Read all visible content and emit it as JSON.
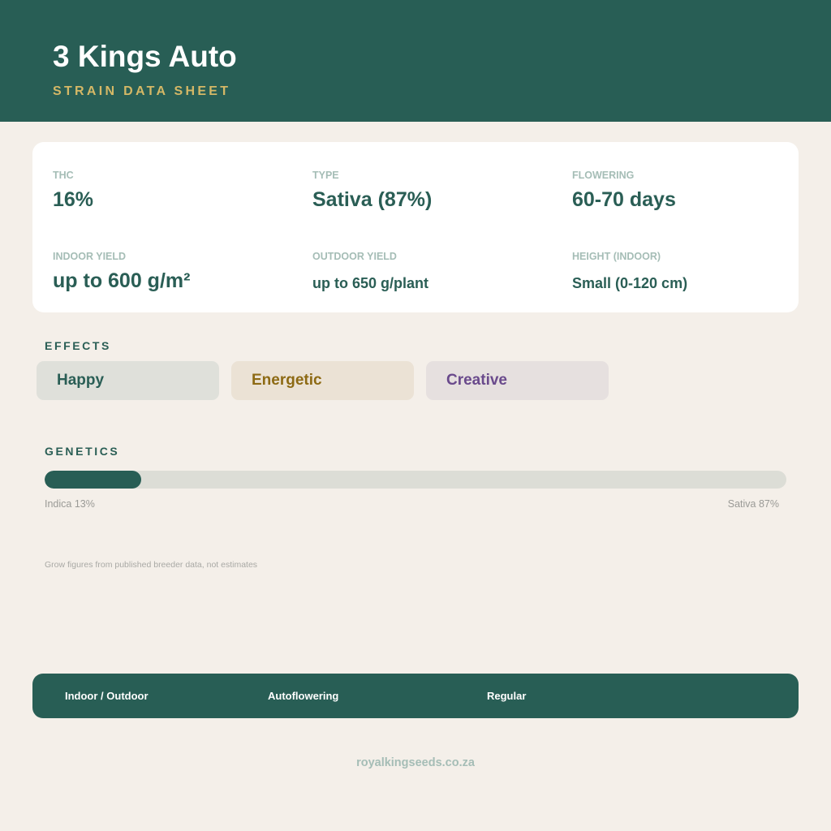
{
  "header": {
    "title": "3 Kings Auto",
    "subtitle": "STRAIN DATA SHEET"
  },
  "stats": [
    {
      "label": "THC",
      "value": "16%"
    },
    {
      "label": "TYPE",
      "value": "Sativa (87%)"
    },
    {
      "label": "FLOWERING",
      "value": "60-70 days"
    },
    {
      "label": "INDOOR YIELD",
      "value": "up to 600 g/m²"
    },
    {
      "label": "OUTDOOR YIELD",
      "value": "up to 650 g/plant"
    },
    {
      "label": "HEIGHT (INDOOR)",
      "value": "Small (0-120 cm)"
    }
  ],
  "effects": {
    "title": "EFFECTS",
    "items": [
      {
        "label": "Happy",
        "color": "#2a5e55",
        "background": "#dfe0da"
      },
      {
        "label": "Energetic",
        "color": "#8d6a14",
        "background": "#ebe2d5"
      },
      {
        "label": "Creative",
        "color": "#6a4a8c",
        "background": "#e6e0df"
      }
    ]
  },
  "genetics": {
    "title": "GENETICS",
    "indica_percent": 13,
    "sativa_percent": 87,
    "indica_label": "Indica 13%",
    "sativa_label": "Sativa 87%"
  },
  "disclaimer": "Grow figures from published breeder data, not estimates",
  "footer": {
    "tags": [
      "Indoor / Outdoor",
      "Autoflowering",
      "Regular"
    ]
  },
  "website": "royalkingseeds.co.za",
  "colors": {
    "primary": "#285e55",
    "accent": "#d5b866",
    "background": "#f4efe9"
  }
}
